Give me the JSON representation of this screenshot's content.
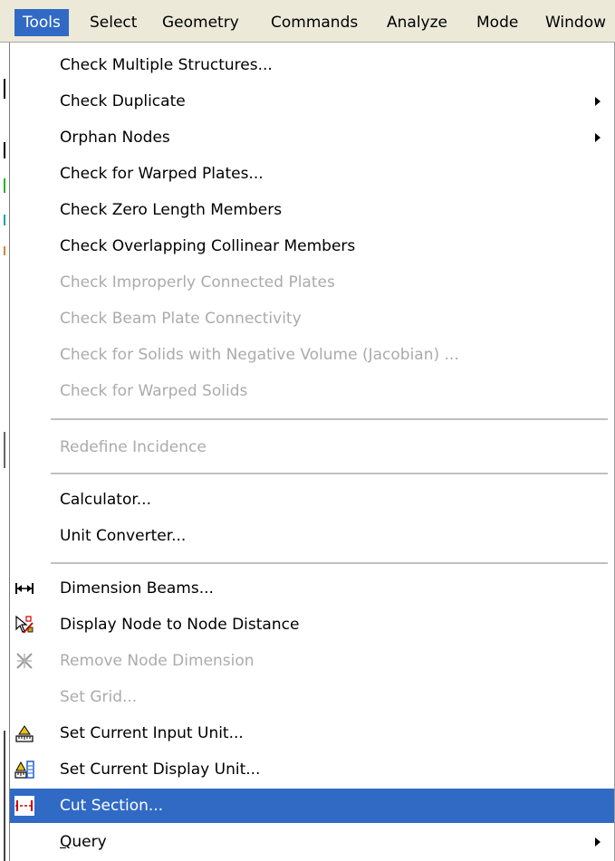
{
  "menubar": {
    "items": [
      "Tools",
      "Select",
      "Geometry",
      "Commands",
      "Analyze",
      "Mode",
      "Window"
    ]
  },
  "menu": {
    "check_multiple_structures": "Check Multiple Structures...",
    "check_duplicate": "Check Duplicate",
    "orphan_nodes": "Orphan Nodes",
    "check_warped_plates": "Check for Warped Plates...",
    "check_zero_length": "Check Zero Length Members",
    "check_overlapping": "Check Overlapping Collinear Members",
    "check_improperly_connected": "Check Improperly Connected Plates",
    "check_beam_plate": "Check Beam Plate Connectivity",
    "check_negative_volume": "Check for Solids with Negative Volume (Jacobian) ...",
    "check_warped_solids": "Check for Warped Solids",
    "redefine_incidence": "Redefine Incidence",
    "calculator": "Calculator...",
    "unit_converter": "Unit Converter...",
    "dimension_beams": "Dimension Beams...",
    "display_node_distance": "Display Node to Node Distance",
    "remove_node_dimension": "Remove Node Dimension",
    "set_grid": "Set Grid...",
    "set_input_unit": "Set Current Input Unit...",
    "set_display_unit": "Set Current Display Unit...",
    "cut_section": "Cut Section...",
    "query_first": "Q",
    "query_rest": "uery"
  },
  "colors": {
    "highlight": "#316ac5",
    "disabled_text": "#ababab",
    "menubar_bg": "#ece9d8"
  }
}
